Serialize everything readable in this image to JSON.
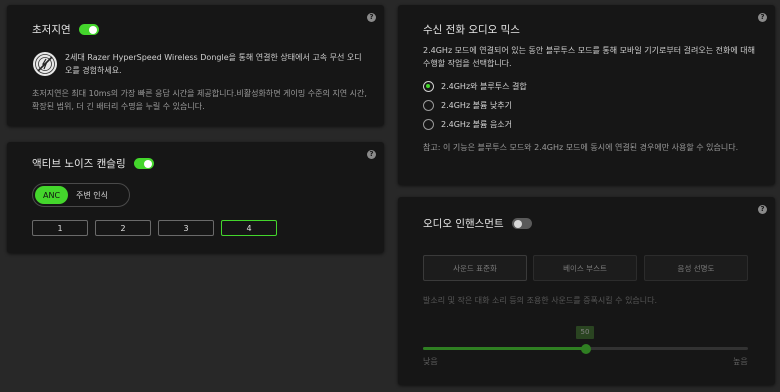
{
  "low_latency": {
    "title": "초저지연",
    "enabled": true,
    "dongle_text": "2세대 Razer HyperSpeed Wireless Dongle을 통해 연결한 상태에서 고속 무선 오디오를 경험하세요.",
    "description": "초저지연은 최대 10ms의 가장 빠른 응답 시간을 제공합니다.비활성화하면 게이밍 수준의 지연 시간, 확장된 범위, 더 긴 배터리 수명을 누릴 수 있습니다."
  },
  "anc": {
    "title": "액티브 노이즈 캔슬링",
    "enabled": true,
    "modes": [
      "ANC",
      "주변 인식"
    ],
    "active_mode": "ANC",
    "levels": [
      "1",
      "2",
      "3",
      "4"
    ],
    "active_level": "4"
  },
  "call_mix": {
    "title": "수신 전화 오디오 믹스",
    "description": "2.4GHz 모드에 연결되어 있는 동안 블루투스 모드를 통해 모바일 기기로부터 걸려오는 전화에 대해 수행할 작업을 선택합니다.",
    "options": [
      "2.4GHz와 블루투스 결합",
      "2.4GHz 볼륨 낮추기",
      "2.4GHz 볼륨 음소거"
    ],
    "selected": "2.4GHz와 블루투스 결합",
    "note": "참고: 이 기능은 블루투스 모드와 2.4GHz 모드에 동시에 연결된 경우에만 사용할 수 있습니다."
  },
  "audio_enhancement": {
    "title": "오디오 인핸스먼트",
    "enabled": false,
    "options": [
      "사운드 표준화",
      "베이스 부스트",
      "음성 선명도"
    ],
    "selected": "사운드 표준화",
    "description": "발소리 및 작은 대화 소리 등의 조용한 사운드를 증폭시킬 수 있습니다.",
    "slider_value": "50",
    "slider_fraction": 0.5,
    "slider_min_label": "낮음",
    "slider_max_label": "높음"
  },
  "help_glyph": "?",
  "colors": {
    "accent": "#44d62c",
    "card": "#161616",
    "background": "#282828"
  }
}
